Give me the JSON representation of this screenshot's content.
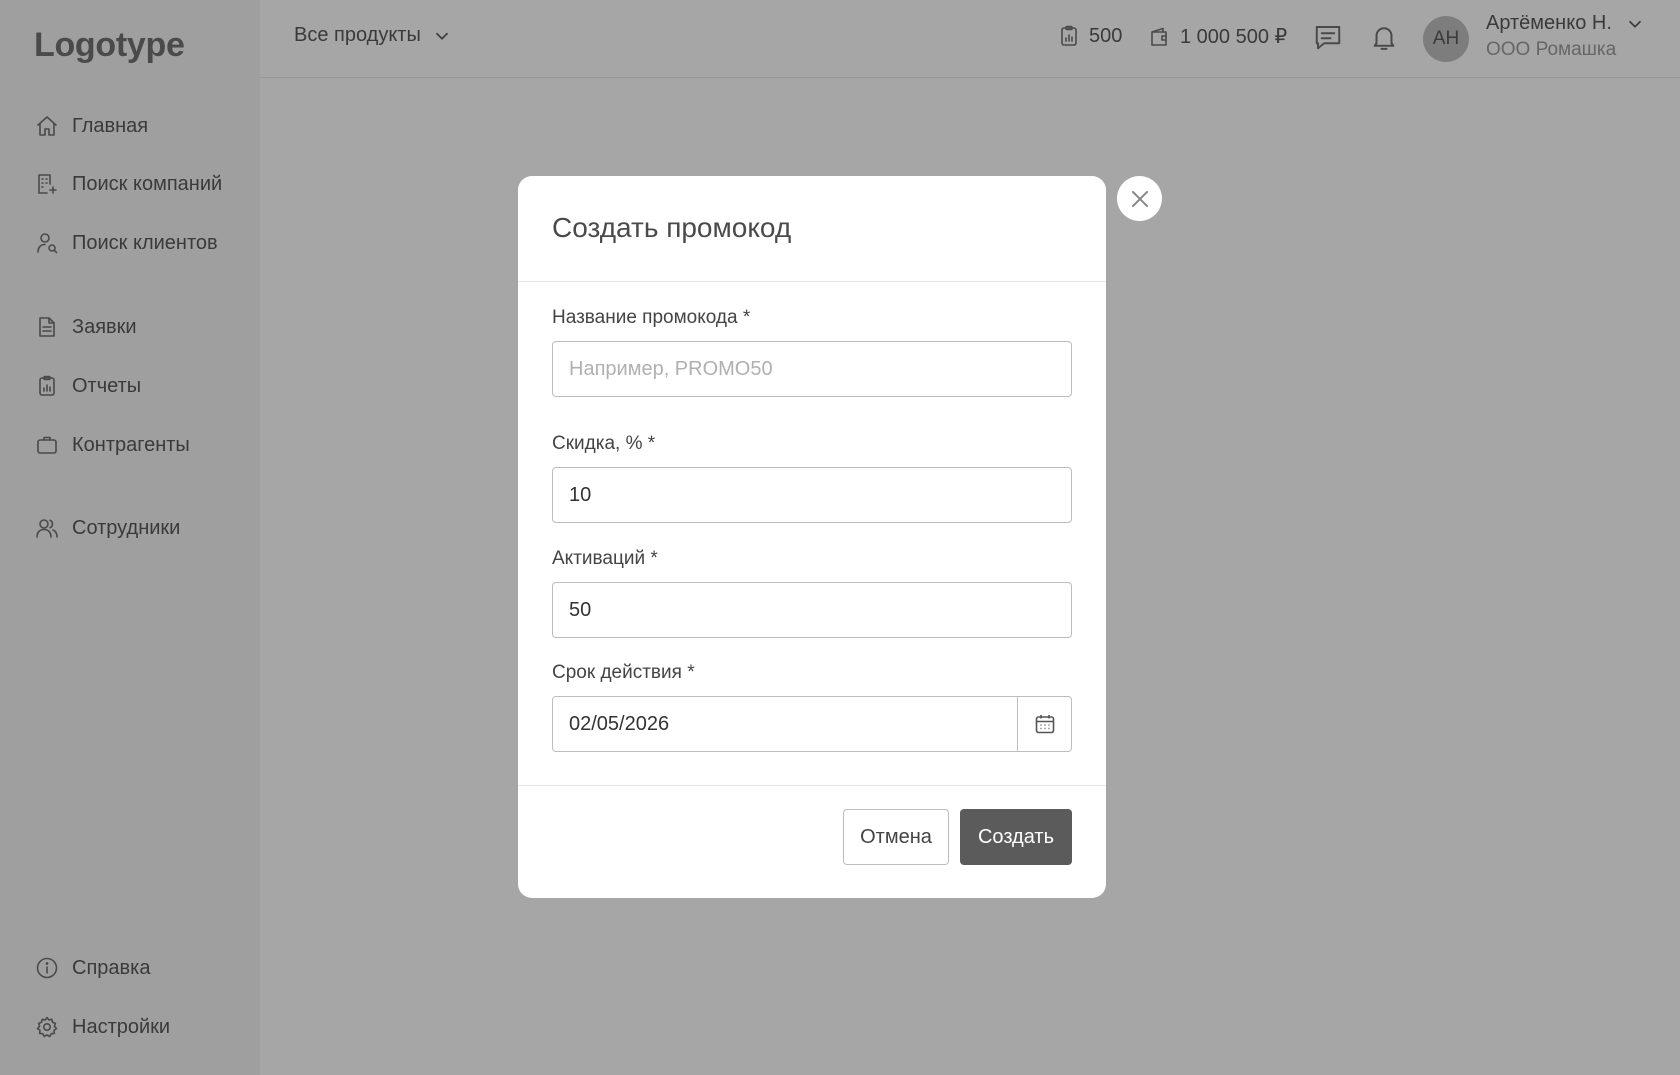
{
  "sidebar": {
    "logo": "Logotype",
    "items": [
      {
        "label": "Главная",
        "icon": "home-icon"
      },
      {
        "label": "Поиск компаний",
        "icon": "building-search-icon"
      },
      {
        "label": "Поиск клиентов",
        "icon": "user-search-icon"
      },
      {
        "label": "Заявки",
        "icon": "document-icon"
      },
      {
        "label": "Отчеты",
        "icon": "clipboard-chart-icon"
      },
      {
        "label": "Контрагенты",
        "icon": "briefcase-icon"
      },
      {
        "label": "Сотрудники",
        "icon": "users-icon"
      },
      {
        "label": "Справка",
        "icon": "info-icon"
      },
      {
        "label": "Настройки",
        "icon": "gear-icon"
      }
    ]
  },
  "header": {
    "products_label": "Все продукты",
    "reports_count": "500",
    "balance": "1 000 500 ₽",
    "avatar_initials": "АН",
    "user_name": "Артёменко Н.",
    "user_org": "ООО Ромашка"
  },
  "modal": {
    "title": "Создать промокод",
    "name_label": "Название промокода *",
    "name_placeholder": "Например, PROMO50",
    "name_value": "",
    "discount_label": "Скидка, % *",
    "discount_value": "10",
    "activations_label": "Активаций *",
    "activations_value": "50",
    "expiry_label": "Срок действия *",
    "expiry_value": "02/05/2026",
    "cancel_label": "Отмена",
    "create_label": "Создать"
  },
  "colors": {
    "overlay": "#a6a6a6",
    "sidebar": "#9f9f9f",
    "primary_button": "#5b5b5b",
    "avatar": "#7d7d7d"
  }
}
